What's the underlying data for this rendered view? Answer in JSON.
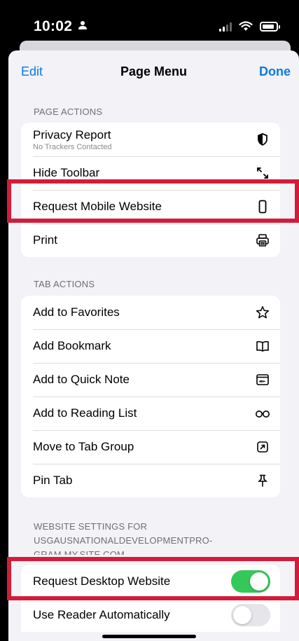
{
  "status_bar": {
    "time": "10:02",
    "person_icon": "person-icon",
    "signal_icon": "cellular-signal-icon",
    "wifi_icon": "wifi-icon",
    "battery_icon": "battery-icon"
  },
  "nav": {
    "edit_label": "Edit",
    "title": "Page Menu",
    "done_label": "Done"
  },
  "sections": {
    "page_actions": {
      "header": "PAGE ACTIONS",
      "items": [
        {
          "label": "Privacy Report",
          "sublabel": "No Trackers Contacted",
          "icon": "shield-icon"
        },
        {
          "label": "Hide Toolbar",
          "icon": "resize-arrows-icon"
        },
        {
          "label": "Request Mobile Website",
          "icon": "phone-icon"
        },
        {
          "label": "Print",
          "icon": "printer-icon"
        }
      ]
    },
    "tab_actions": {
      "header": "TAB ACTIONS",
      "items": [
        {
          "label": "Add to Favorites",
          "icon": "star-icon"
        },
        {
          "label": "Add Bookmark",
          "icon": "book-icon"
        },
        {
          "label": "Add to Quick Note",
          "icon": "quick-note-icon"
        },
        {
          "label": "Add to Reading List",
          "icon": "glasses-icon"
        },
        {
          "label": "Move to Tab Group",
          "icon": "move-arrow-icon"
        },
        {
          "label": "Pin Tab",
          "icon": "pin-icon"
        }
      ]
    },
    "website_settings": {
      "header_line1": "WEBSITE SETTINGS FOR",
      "header_line2": "USGAUSNATIONALDEVELOPMENTPRO-",
      "header_line3": "GRAM.MY.SITE.COM",
      "items": [
        {
          "label": "Request Desktop Website",
          "toggle_on": true
        },
        {
          "label": "Use Reader Automatically",
          "toggle_on": false
        }
      ]
    }
  },
  "colors": {
    "accent": "#0a7ae6",
    "toggle_on": "#34c759",
    "highlight": "#d41c39",
    "background": "#f2f2f7"
  }
}
